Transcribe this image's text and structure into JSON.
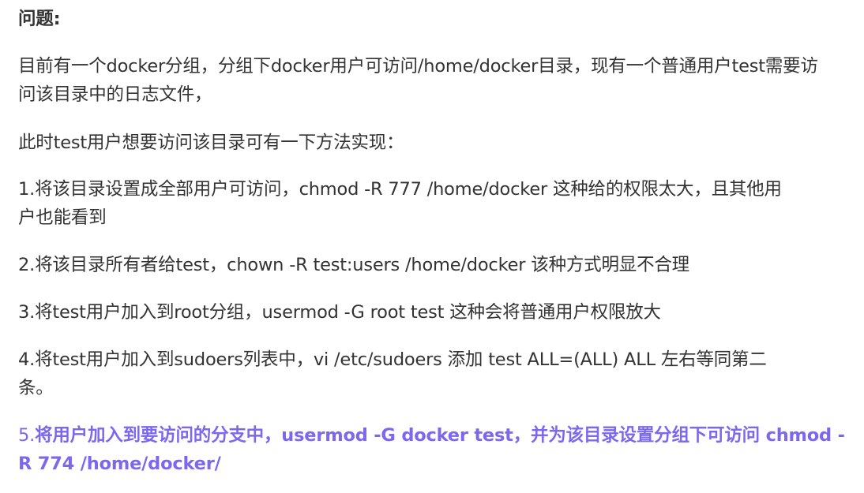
{
  "article": {
    "heading": "问题:",
    "p1_line1": "目前有一个docker分组，分组下docker用户可访问/home/docker目录，现有一个普通用户test需要访",
    "p1_line2": "问该目录中的日志文件，",
    "p2": "此时test用户想要访问该目录可有一下方法实现：",
    "item1_line1": "1.将该目录设置成全部用户可访问，chmod -R 777 /home/docker         这种给的权限太大，且其他用",
    "item1_line2": "户也能看到",
    "item2": "2.将该目录所有者给test，chown -R test:users /home/docker   该种方式明显不合理",
    "item3": "3.将test用户加入到root分组，usermod -G root test    这种会将普通用户权限放大",
    "item4_line1": "4.将test用户加入到sudoers列表中，vi  /etc/sudoers    添加 test   ALL=(ALL)     ALL     左右等同第二",
    "item4_line2": "条。",
    "item5_prefix": "5.",
    "item5_line1": "将用户加入到要访问的分支中，usermod -G docker test，并为该目录设置分组下可访问 chmod -",
    "item5_line2": "R 774 /home/docker/"
  },
  "colors": {
    "text": "#333333",
    "emphasis": "#7b68ee",
    "background": "#ffffff"
  }
}
